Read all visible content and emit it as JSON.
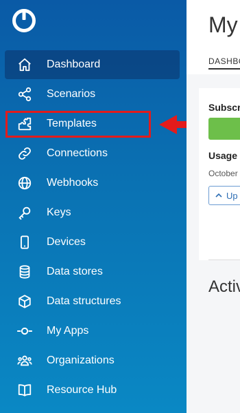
{
  "app": {
    "logo_icon": "make-logo-icon"
  },
  "sidebar": {
    "items": [
      {
        "label": "Dashboard",
        "icon": "home-icon",
        "active": true
      },
      {
        "label": "Scenarios",
        "icon": "share-nodes-icon"
      },
      {
        "label": "Templates",
        "icon": "puzzle-icon"
      },
      {
        "label": "Connections",
        "icon": "link-icon"
      },
      {
        "label": "Webhooks",
        "icon": "globe-icon"
      },
      {
        "label": "Keys",
        "icon": "key-icon"
      },
      {
        "label": "Devices",
        "icon": "mobile-icon"
      },
      {
        "label": "Data stores",
        "icon": "database-icon"
      },
      {
        "label": "Data structures",
        "icon": "cube-icon"
      },
      {
        "label": "My Apps",
        "icon": "app-connector-icon"
      },
      {
        "label": "Organizations",
        "icon": "users-icon"
      },
      {
        "label": "Resource Hub",
        "icon": "book-icon"
      }
    ]
  },
  "annotation": {
    "highlight_color": "#e31b1b",
    "arrow_color": "#e31b1b",
    "target": "Templates"
  },
  "main": {
    "title": "My",
    "tab": "DASHBO",
    "subscription_label": "Subscr",
    "usage_label": "Usage",
    "date_text": "October",
    "button_label": "Up",
    "section_title": "Activ"
  },
  "colors": {
    "sidebar_top": "#0a5aa6",
    "sidebar_bottom": "#0a88c4",
    "accent_green": "#6dbf4a",
    "link_blue": "#2f6fb5"
  }
}
